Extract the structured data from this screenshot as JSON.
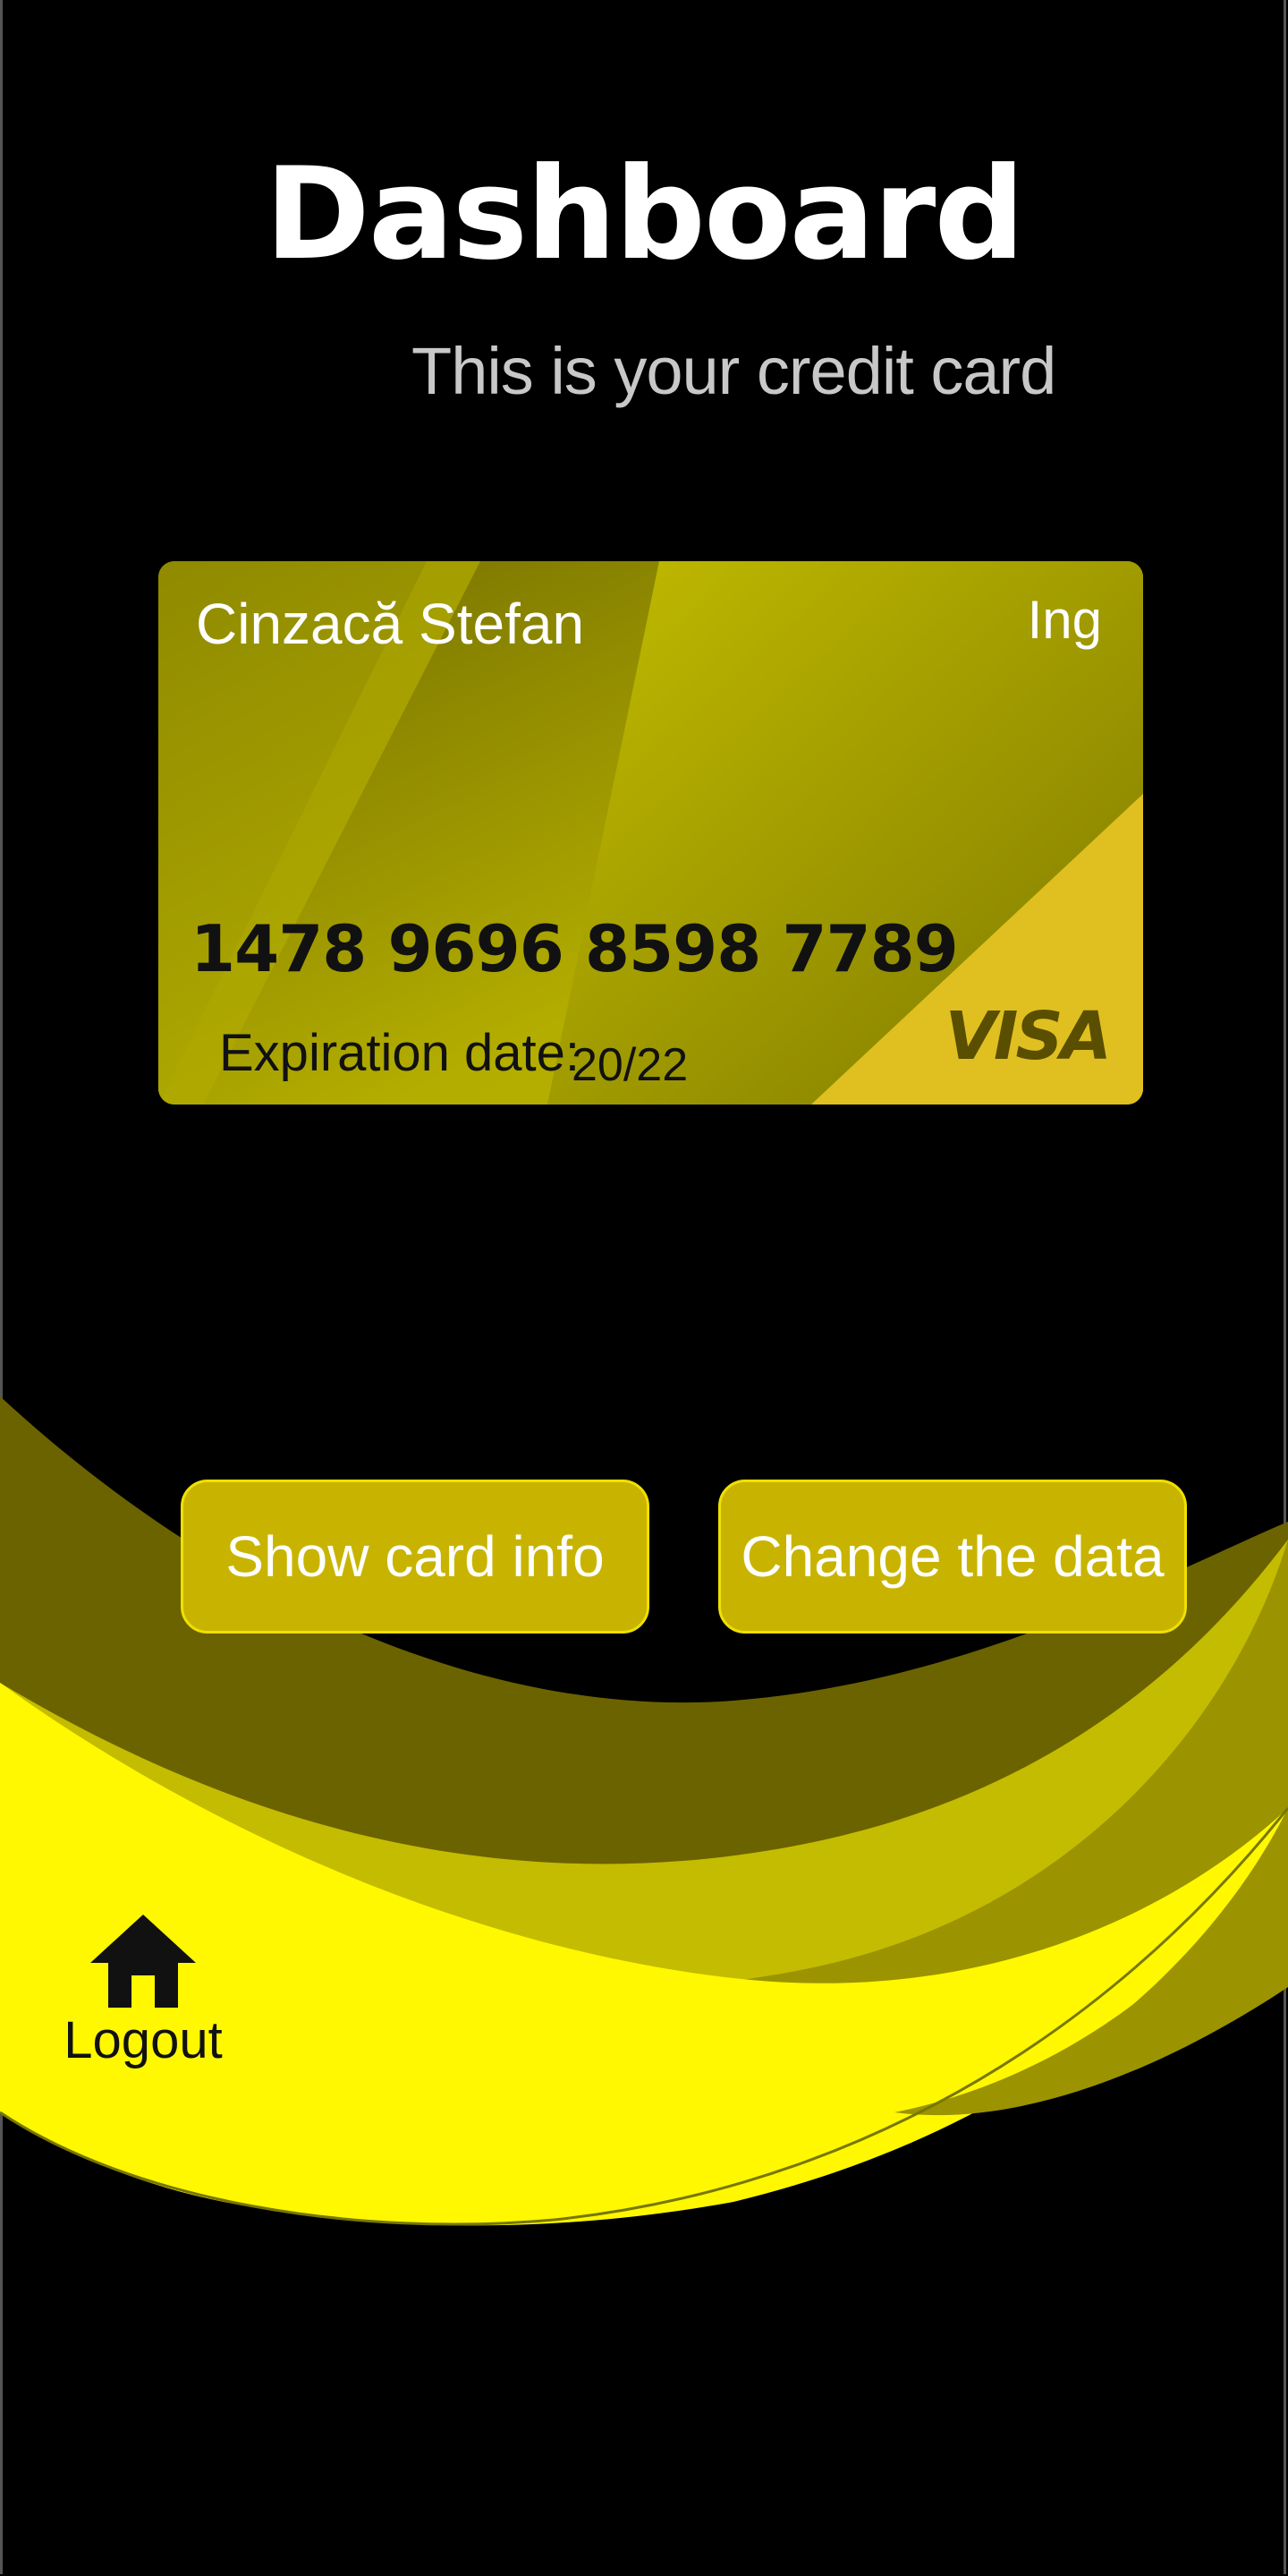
{
  "header": {
    "title": "Dashboard",
    "subtitle": "This is your credit card"
  },
  "card": {
    "holder": "Cinzacă Stefan",
    "bank": "Ing",
    "number": "1478 9696 8598 7789",
    "expiration_label": "Expiration date:",
    "expiration_value": "20/22",
    "network": "VISA",
    "colors": {
      "base": "#c2bc00",
      "accent": "#e0c020",
      "text_dark": "#111111"
    }
  },
  "actions": {
    "show_card_info": "Show card info",
    "change_data": "Change the data"
  },
  "nav": {
    "logout_label": "Logout",
    "logout_icon": "home-icon"
  },
  "theme": {
    "background": "#000000",
    "primary_yellow": "#fff800",
    "dark_yellow": "#6b6300",
    "mid_yellow": "#c4bc00",
    "olive": "#9b9400",
    "button_fill": "#c8b400",
    "button_border": "#f0e000"
  }
}
